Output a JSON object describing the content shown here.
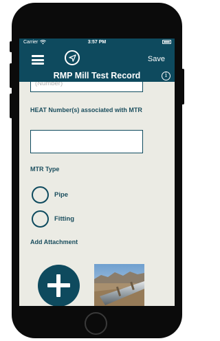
{
  "status_bar": {
    "carrier": "Carrier",
    "time": "3:57 PM"
  },
  "toolbar": {
    "save_label": "Save"
  },
  "header": {
    "title": "RMP Mill Test Record",
    "info_symbol": "i"
  },
  "form": {
    "number_placeholder": "(Number)",
    "heat_label": "HEAT Number(s) associated with MTR",
    "heat_value": "",
    "mtr_type_label": "MTR Type",
    "mtr_options": [
      {
        "label": "Pipe",
        "selected": false
      },
      {
        "label": "Fitting",
        "selected": false
      }
    ],
    "attachment_label": "Add Attachment"
  },
  "icons": {
    "menu": "hamburger-menu-icon",
    "navigate": "location-arrow-icon",
    "info": "info-icon",
    "add": "plus-icon",
    "wifi": "wifi-icon",
    "battery": "battery-icon"
  },
  "colors": {
    "brand": "#0e4a5e",
    "label": "#1b4e5e",
    "background": "#ebebe4"
  }
}
